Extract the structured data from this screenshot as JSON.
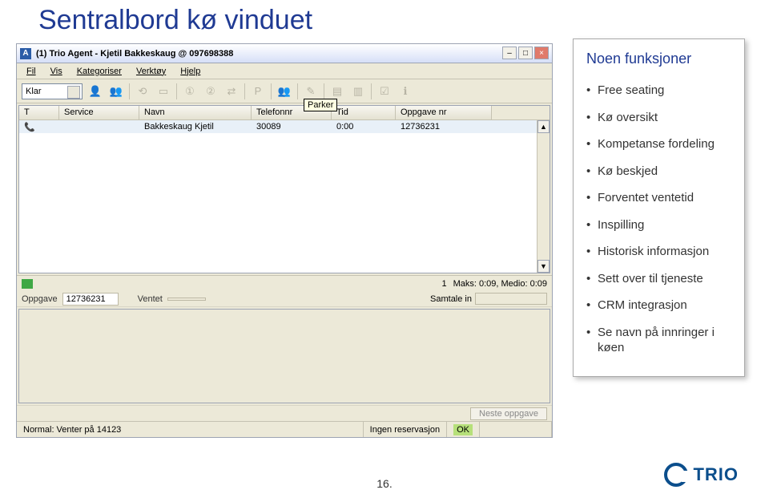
{
  "slide": {
    "title": "Sentralbord kø vinduet",
    "page_number": "16."
  },
  "sidebar": {
    "title": "Noen funksjoner",
    "items": [
      "Free seating",
      "Kø oversikt",
      "Kompetanse fordeling",
      "Kø beskjed",
      "Forventet ventetid",
      "Inspilling",
      "Historisk informasjon",
      "Sett over til tjeneste",
      "CRM integrasjon",
      "Se navn på innringer i køen"
    ]
  },
  "app": {
    "title": "(1) Trio Agent - Kjetil Bakkeskaug @ 097698388",
    "menu": [
      "Fil",
      "Vis",
      "Kategoriser",
      "Verktøy",
      "Hjelp"
    ],
    "combo_label": "Klar",
    "tooltip": "Parker",
    "table": {
      "columns": [
        "T",
        "Service",
        "Navn",
        "Telefonnr",
        "Tid",
        "Oppgave nr"
      ],
      "row": {
        "t": "",
        "service": "",
        "navn": "Bakkeskaug Kjetil",
        "tel": "30089",
        "tid": "0:00",
        "opp": "12736231"
      }
    },
    "status_strip": {
      "count": "1",
      "stats": "Maks: 0:09, Medio: 0:09"
    },
    "info": {
      "oppgave_label": "Oppgave",
      "oppgave_val": "12736231",
      "ventet_label": "Ventet",
      "samtale_label": "Samtale in"
    },
    "neste_label": "Neste oppgave",
    "bottom": {
      "left": "Normal: Venter på 14123",
      "res": "Ingen reservasjon",
      "ok": "OK"
    }
  },
  "logo_text": "TRIO"
}
